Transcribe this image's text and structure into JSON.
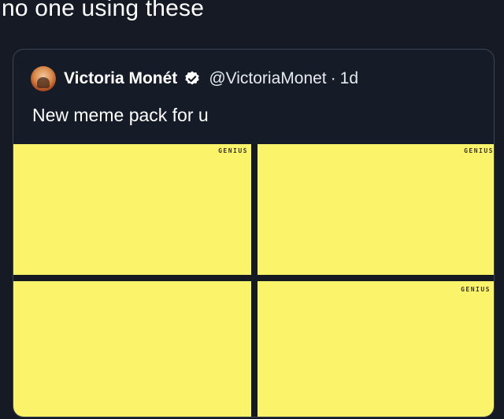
{
  "caption": {
    "text": "no one using these"
  },
  "tweet": {
    "author_name": "Victoria Monét",
    "handle": "@VictoriaMonet",
    "separator": "·",
    "time": "1d",
    "text": "New meme pack for u",
    "verified_icon": "verified-badge-icon",
    "avatar": "avatar-icon"
  },
  "media": {
    "tile_color": "#fbf46b",
    "tiles": [
      {
        "watermark": "GENIUS"
      },
      {
        "watermark": "GENIUS"
      },
      {
        "watermark": ""
      },
      {
        "watermark": "GENIUS"
      }
    ]
  }
}
